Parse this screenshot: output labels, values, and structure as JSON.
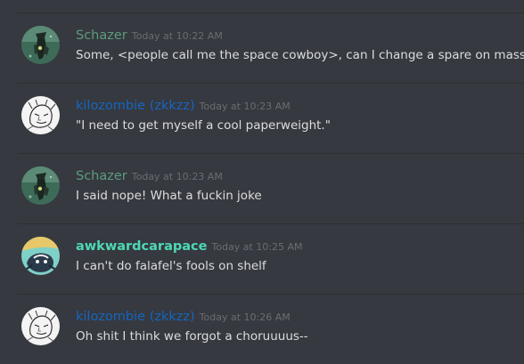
{
  "messages": [
    {
      "username": "Schazer",
      "timestamp": "Today at 10:22 AM",
      "content": "Some, <people call me the space cowboy>, can I change a spare on masse?",
      "avatar": "schazer-avatar",
      "name_color": "#5d9b7e"
    },
    {
      "username": "kilozombie (zkkzz)",
      "timestamp": "Today at 10:23 AM",
      "content": "\"I need to get myself a cool paperweight.\"",
      "avatar": "kilozombie-avatar",
      "name_color": "#1565c0"
    },
    {
      "username": "Schazer",
      "timestamp": "Today at 10:23 AM",
      "content": "I said nope! What a fuckin joke",
      "avatar": "schazer-avatar",
      "name_color": "#5d9b7e"
    },
    {
      "username": "awkwardcarapace",
      "timestamp": "Today at 10:25 AM",
      "content": "I can't do falafel's fools on shelf",
      "avatar": "awkwardcarapace-avatar",
      "name_color": "#4dd9b3"
    },
    {
      "username": "kilozombie (zkkzz)",
      "timestamp": "Today at 10:26 AM",
      "content": "Oh shit I think we forgot a choruuuus--",
      "avatar": "kilozombie-avatar",
      "name_color": "#1565c0"
    }
  ],
  "theme": {
    "background": "#36393f",
    "divider": "#2c2f34",
    "text": "#dcddde",
    "timestamp": "#6a6d72"
  }
}
